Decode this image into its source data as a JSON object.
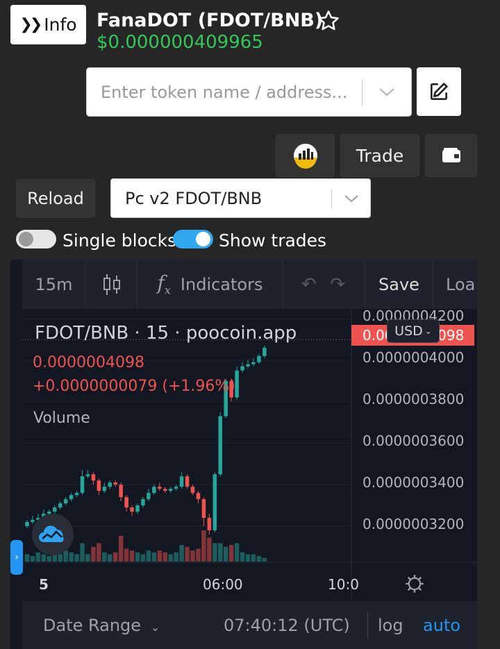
{
  "header": {
    "info_label": "Info",
    "title": "FanaDOT (FDOT/BNB)",
    "price": "$0.000000409965"
  },
  "search": {
    "placeholder": "Enter token name / address..."
  },
  "actions": {
    "trade_label": "Trade",
    "reload_label": "Reload"
  },
  "pair_select": {
    "value": "Pc v2 FDOT/BNB"
  },
  "toggles": {
    "single_blocks": {
      "label": "Single blocks",
      "on": false
    },
    "show_trades": {
      "label": "Show trades",
      "on": true
    }
  },
  "chart_toolbar": {
    "interval": "15m",
    "indicators": "Indicators",
    "save": "Save",
    "load": "Loa"
  },
  "colors": {
    "up": "#26a69a",
    "down": "#ef5350",
    "accent": "#2196f3",
    "price_green": "#34c759"
  },
  "chart_data": {
    "type": "candlestick",
    "legend_title": "FDOT/BNB · 15 · poocoin.app",
    "last_price": "0.0000004098",
    "change": "+0.0000000079 (+1.96%)",
    "volume_label": "Volume",
    "currency": "USD",
    "y_ticks": [
      "0.0000004200",
      "0.0000004000",
      "0.0000003800",
      "0.0000003600",
      "0.0000003400",
      "0.0000003200"
    ],
    "y_range": [
      3.16e-07,
      4.2e-07
    ],
    "x_ticks": [
      "5",
      "06:00",
      "10:0"
    ],
    "candles": [
      {
        "o": 3.2,
        "c": 3.22,
        "h": 3.23,
        "l": 3.19,
        "v": 0.4
      },
      {
        "o": 3.22,
        "c": 3.23,
        "h": 3.25,
        "l": 3.21,
        "v": 0.3
      },
      {
        "o": 3.23,
        "c": 3.24,
        "h": 3.26,
        "l": 3.22,
        "v": 0.5
      },
      {
        "o": 3.24,
        "c": 3.26,
        "h": 3.28,
        "l": 3.23,
        "v": 0.4
      },
      {
        "o": 3.26,
        "c": 3.27,
        "h": 3.28,
        "l": 3.25,
        "v": 0.3
      },
      {
        "o": 3.27,
        "c": 3.29,
        "h": 3.3,
        "l": 3.26,
        "v": 0.5
      },
      {
        "o": 3.29,
        "c": 3.31,
        "h": 3.32,
        "l": 3.28,
        "v": 0.4
      },
      {
        "o": 3.31,
        "c": 3.33,
        "h": 3.34,
        "l": 3.3,
        "v": 0.6
      },
      {
        "o": 3.33,
        "c": 3.35,
        "h": 3.36,
        "l": 3.32,
        "v": 0.5
      },
      {
        "o": 3.35,
        "c": 3.36,
        "h": 3.37,
        "l": 3.34,
        "v": 0.4
      },
      {
        "o": 3.36,
        "c": 3.44,
        "h": 3.47,
        "l": 3.35,
        "v": 1.0
      },
      {
        "o": 3.44,
        "c": 3.45,
        "h": 3.47,
        "l": 3.43,
        "v": 0.4
      },
      {
        "o": 3.45,
        "c": 3.42,
        "h": 3.46,
        "l": 3.4,
        "v": 0.8
      },
      {
        "o": 3.42,
        "c": 3.37,
        "h": 3.43,
        "l": 3.35,
        "v": 1.0
      },
      {
        "o": 3.37,
        "c": 3.39,
        "h": 3.41,
        "l": 3.36,
        "v": 0.5
      },
      {
        "o": 3.39,
        "c": 3.41,
        "h": 3.42,
        "l": 3.38,
        "v": 0.4
      },
      {
        "o": 3.41,
        "c": 3.4,
        "h": 3.42,
        "l": 3.39,
        "v": 0.5
      },
      {
        "o": 3.4,
        "c": 3.34,
        "h": 3.41,
        "l": 3.32,
        "v": 1.4
      },
      {
        "o": 3.34,
        "c": 3.29,
        "h": 3.35,
        "l": 3.27,
        "v": 0.7
      },
      {
        "o": 3.29,
        "c": 3.27,
        "h": 3.3,
        "l": 3.25,
        "v": 0.6
      },
      {
        "o": 3.27,
        "c": 3.3,
        "h": 3.31,
        "l": 3.26,
        "v": 0.5
      },
      {
        "o": 3.3,
        "c": 3.33,
        "h": 3.34,
        "l": 3.29,
        "v": 0.4
      },
      {
        "o": 3.33,
        "c": 3.36,
        "h": 3.38,
        "l": 3.32,
        "v": 0.6
      },
      {
        "o": 3.36,
        "c": 3.39,
        "h": 3.4,
        "l": 3.35,
        "v": 0.5
      },
      {
        "o": 3.39,
        "c": 3.38,
        "h": 3.41,
        "l": 3.37,
        "v": 0.6
      },
      {
        "o": 3.38,
        "c": 3.37,
        "h": 3.39,
        "l": 3.36,
        "v": 0.5
      },
      {
        "o": 3.37,
        "c": 3.38,
        "h": 3.39,
        "l": 3.36,
        "v": 0.4
      },
      {
        "o": 3.38,
        "c": 3.39,
        "h": 3.4,
        "l": 3.37,
        "v": 0.5
      },
      {
        "o": 3.39,
        "c": 3.44,
        "h": 3.46,
        "l": 3.38,
        "v": 0.9
      },
      {
        "o": 3.44,
        "c": 3.39,
        "h": 3.45,
        "l": 3.38,
        "v": 0.8
      },
      {
        "o": 3.39,
        "c": 3.36,
        "h": 3.4,
        "l": 3.35,
        "v": 0.6
      },
      {
        "o": 3.36,
        "c": 3.33,
        "h": 3.37,
        "l": 3.31,
        "v": 0.7
      },
      {
        "o": 3.33,
        "c": 3.24,
        "h": 3.34,
        "l": 3.2,
        "v": 1.7
      },
      {
        "o": 3.24,
        "c": 3.18,
        "h": 3.26,
        "l": 3.16,
        "v": 1.3
      },
      {
        "o": 3.18,
        "c": 3.45,
        "h": 3.46,
        "l": 3.17,
        "v": 1.0
      },
      {
        "o": 3.45,
        "c": 3.73,
        "h": 3.75,
        "l": 3.44,
        "v": 1.0
      },
      {
        "o": 3.73,
        "c": 3.9,
        "h": 3.91,
        "l": 3.72,
        "v": 0.8
      },
      {
        "o": 3.9,
        "c": 3.82,
        "h": 3.91,
        "l": 3.8,
        "v": 0.9
      },
      {
        "o": 3.82,
        "c": 3.95,
        "h": 3.97,
        "l": 3.81,
        "v": 1.0
      },
      {
        "o": 3.95,
        "c": 3.97,
        "h": 3.99,
        "l": 3.94,
        "v": 0.5
      },
      {
        "o": 3.97,
        "c": 3.98,
        "h": 4.0,
        "l": 3.96,
        "v": 0.4
      },
      {
        "o": 3.98,
        "c": 3.99,
        "h": 4.01,
        "l": 3.97,
        "v": 0.4
      },
      {
        "o": 3.99,
        "c": 4.02,
        "h": 4.03,
        "l": 3.98,
        "v": 0.3
      },
      {
        "o": 4.02,
        "c": 4.06,
        "h": 4.07,
        "l": 4.01,
        "v": 0.2
      }
    ]
  },
  "chart_footer": {
    "date_range": "Date Range",
    "time": "07:40:12 (UTC)",
    "log": "log",
    "auto": "auto"
  }
}
